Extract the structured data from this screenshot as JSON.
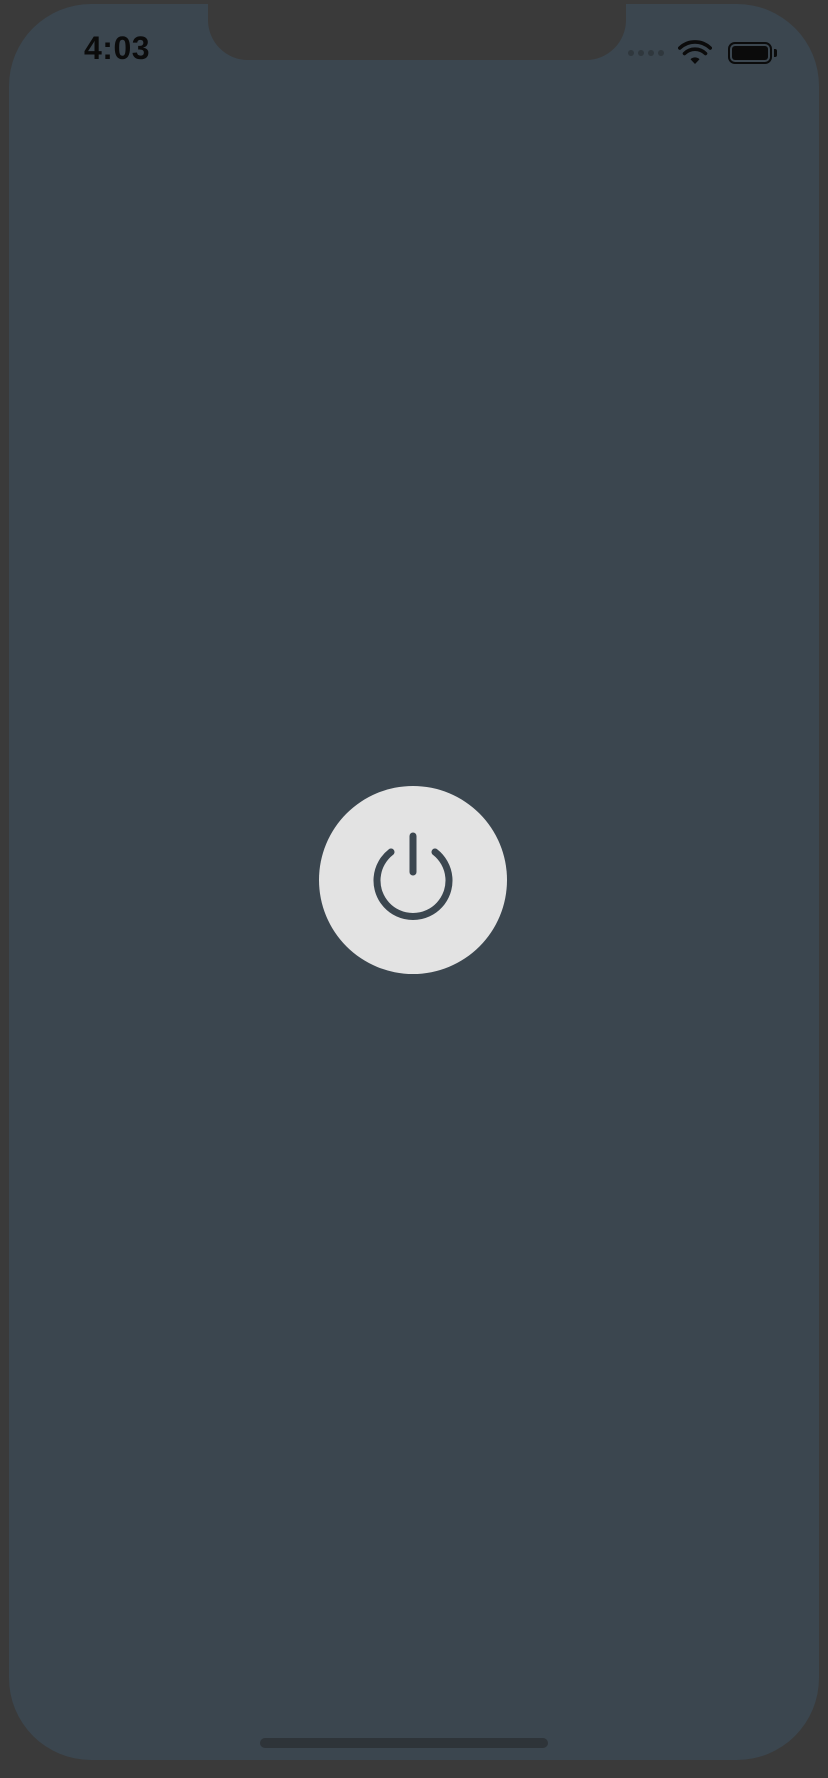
{
  "status_bar": {
    "time": "4:03",
    "signal_icon": "cellular-signal-icon",
    "wifi_icon": "wifi-icon",
    "battery_icon": "battery-icon",
    "battery_level": 1.0
  },
  "main": {
    "power_button_icon": "power-icon"
  },
  "colors": {
    "background": "#3b464f",
    "bezel": "#3a3a3a",
    "button": "#e3e3e3",
    "icon": "#3b464f"
  }
}
